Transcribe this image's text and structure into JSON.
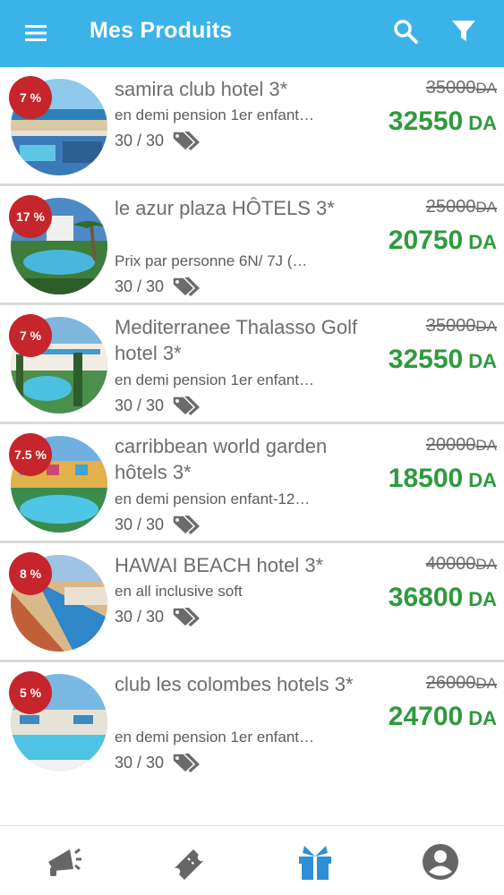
{
  "header": {
    "title": "Mes Produits",
    "menu_icon": "menu-icon",
    "search_icon": "search-icon",
    "filter_icon": "filter-icon",
    "background": "#3bb3e8"
  },
  "currency": "DA",
  "colors": {
    "discount_badge": "#c6252b",
    "new_price": "#2e9a3d",
    "text": "#6d6d6d"
  },
  "products": [
    {
      "discount": "7 %",
      "name": "samira club hotel 3*",
      "description": "en demi pension 1er enfant…",
      "stock": "30 / 30",
      "old_price": "35000",
      "new_price": "32550"
    },
    {
      "discount": "17 %",
      "name": "le azur plaza HÔTELS 3*",
      "description": "Prix par personne 6N/ 7J (…",
      "stock": "30 / 30",
      "old_price": "25000",
      "new_price": "20750"
    },
    {
      "discount": "7 %",
      "name": "Mediterranee Thalasso Golf hotel 3*",
      "description": "en demi pension 1er enfant…",
      "stock": "30 / 30",
      "old_price": "35000",
      "new_price": "32550"
    },
    {
      "discount": "7.5 %",
      "name": "carribbean world garden hôtels 3*",
      "description": "en demi pension enfant-12…",
      "stock": "30 / 30",
      "old_price": "20000",
      "new_price": "18500"
    },
    {
      "discount": "8 %",
      "name": "HAWAI BEACH hotel 3*",
      "description": "en all inclusive soft",
      "stock": "30 / 30",
      "old_price": "40000",
      "new_price": "36800"
    },
    {
      "discount": "5 %",
      "name": "club les colombes hotels 3*",
      "description": "en demi pension 1er enfant…",
      "stock": "30 / 30",
      "old_price": "26000",
      "new_price": "24700"
    }
  ],
  "bottom_nav": [
    {
      "icon": "megaphone-icon",
      "active": false
    },
    {
      "icon": "ticket-icon",
      "active": false
    },
    {
      "icon": "gift-icon",
      "active": true
    },
    {
      "icon": "account-icon",
      "active": false
    }
  ]
}
